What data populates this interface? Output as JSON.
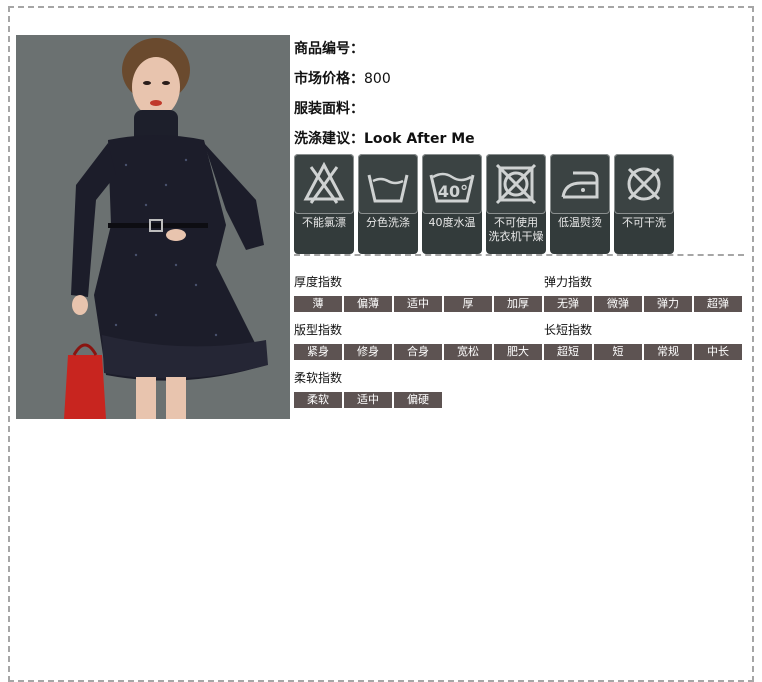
{
  "product": {
    "code_label": "商品编号：",
    "code_value": "",
    "price_label": "市场价格：",
    "price_value": "800",
    "fabric_label": "服装面料：",
    "fabric_value": "",
    "wash_label": "洗涤建议：",
    "wash_value": "Look After Me"
  },
  "care": {
    "items": [
      {
        "icon": "no-bleach-icon",
        "label": "不能氯漂"
      },
      {
        "icon": "separate-wash-icon",
        "label": "分色洗涤"
      },
      {
        "icon": "wash-40-icon",
        "label": "40度水温",
        "temp": "40°"
      },
      {
        "icon": "no-tumble-dry-icon",
        "label_line1": "不可使用",
        "label_line2": "洗衣机干燥"
      },
      {
        "icon": "low-iron-icon",
        "label": "低温熨烫"
      },
      {
        "icon": "no-dry-clean-icon",
        "label": "不可干洗"
      }
    ]
  },
  "indices": {
    "thickness": {
      "title": "厚度指数",
      "options": [
        "薄",
        "偏薄",
        "适中",
        "厚",
        "加厚"
      ]
    },
    "elasticity": {
      "title": "弹力指数",
      "options": [
        "无弹",
        "微弹",
        "弹力",
        "超弹"
      ]
    },
    "fit": {
      "title": "版型指数",
      "options": [
        "紧身",
        "修身",
        "合身",
        "宽松",
        "肥大"
      ]
    },
    "length": {
      "title": "长短指数",
      "options": [
        "超短",
        "短",
        "常规",
        "中长"
      ]
    },
    "softness": {
      "title": "柔软指数",
      "options": [
        "柔软",
        "适中",
        "偏硬"
      ]
    }
  },
  "colors": {
    "cell_bg": "#5d5352",
    "care_bg": "#333b3b",
    "frame_border": "#a6a6a6"
  }
}
